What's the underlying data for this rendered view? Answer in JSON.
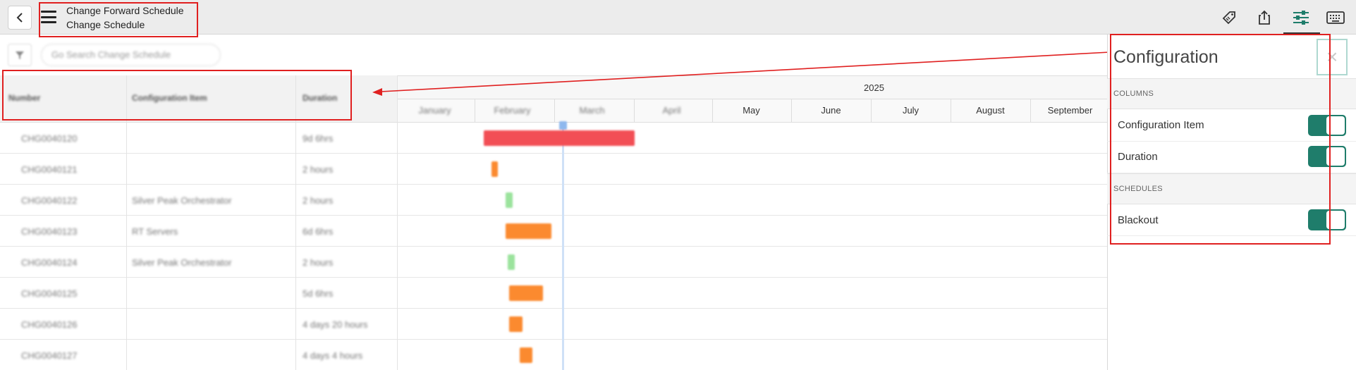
{
  "header": {
    "title_line1": "Change Forward Schedule",
    "title_line2": "Change Schedule",
    "icons": [
      "back-icon",
      "menu-icon",
      "tag-icon",
      "share-icon",
      "settings-sliders-icon",
      "keyboard-icon"
    ]
  },
  "filter": {
    "search_placeholder": "Go Search Change Schedule"
  },
  "grid": {
    "columns": [
      "Number",
      "Configuration Item",
      "Duration"
    ],
    "rows": [
      {
        "number": "CHG0040120",
        "ci": "",
        "duration": "9d 6hrs"
      },
      {
        "number": "CHG0040121",
        "ci": "",
        "duration": "2 hours"
      },
      {
        "number": "CHG0040122",
        "ci": "Silver Peak Orchestrator",
        "duration": "2 hours"
      },
      {
        "number": "CHG0040123",
        "ci": "RT Servers",
        "duration": "6d 6hrs"
      },
      {
        "number": "CHG0040124",
        "ci": "Silver Peak Orchestrator",
        "duration": "2 hours"
      },
      {
        "number": "CHG0040125",
        "ci": "",
        "duration": "5d 6hrs"
      },
      {
        "number": "CHG0040126",
        "ci": "",
        "duration": "4 days 20 hours"
      },
      {
        "number": "CHG0040127",
        "ci": "",
        "duration": "4 days 4 hours"
      }
    ]
  },
  "timeline": {
    "year": "2025",
    "months": [
      "January",
      "February",
      "March",
      "April",
      "May",
      "June",
      "July",
      "August",
      "September"
    ],
    "bar_colors": {
      "red": "#f24e55",
      "orange": "#fb8a2f",
      "green": "#9be39d"
    }
  },
  "config_panel": {
    "title": "Configuration",
    "close_glyph": "×",
    "sections": [
      {
        "label": "COLUMNS",
        "options": [
          {
            "label": "Configuration Item",
            "enabled": true
          },
          {
            "label": "Duration",
            "enabled": true
          }
        ]
      },
      {
        "label": "SCHEDULES",
        "options": [
          {
            "label": "Blackout",
            "enabled": true
          }
        ]
      }
    ],
    "toggle_color": "#1f7d6b"
  },
  "annotation": {
    "color": "#e02020"
  }
}
